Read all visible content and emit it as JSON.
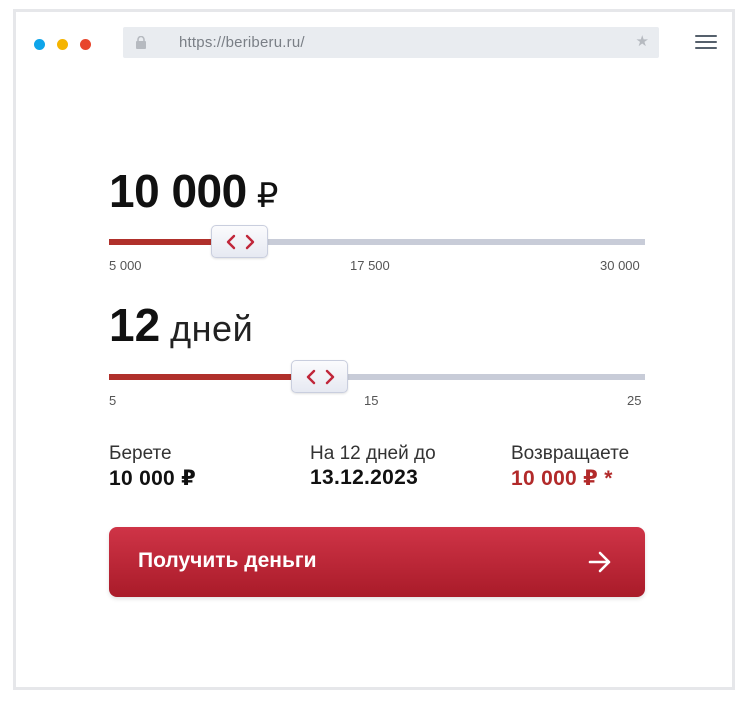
{
  "browser": {
    "url": "https://beriberu.ru/",
    "icons": [
      "lock-icon",
      "star-icon",
      "hamburger-menu-icon"
    ],
    "window_dots": [
      "#0ea5ea",
      "#f5b400",
      "#e8452c"
    ]
  },
  "amount": {
    "value": "10 000",
    "currency": "₽",
    "slider_min_label": "5 000",
    "slider_mid_label": "17 500",
    "slider_max_label": "30 000",
    "slider_fraction": 0.2
  },
  "term": {
    "value": "12",
    "unit": "дней",
    "slider_min_label": "5",
    "slider_mid_label": "15",
    "slider_max_label": "25",
    "slider_fraction": 0.35
  },
  "summary": {
    "take_label": "Берете",
    "take_value": "10 000 ₽",
    "until_label": "На 12 дней до",
    "until_value": "13.12.2023",
    "return_label": "Возвращаете",
    "return_value": "10 000 ₽ *"
  },
  "cta": {
    "label": "Получить деньги",
    "icon": "arrow-right-icon"
  },
  "colors": {
    "accent": "#b0302b",
    "button": "#c02a3c",
    "track": "#c8ccd8"
  }
}
